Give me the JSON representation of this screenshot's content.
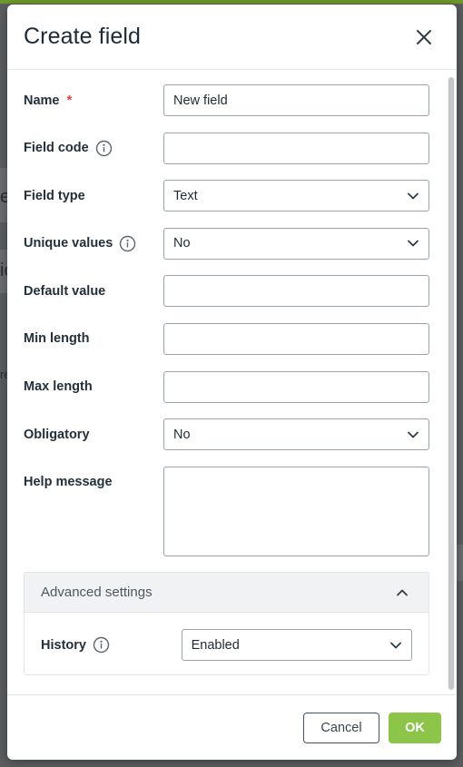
{
  "modal": {
    "title": "Create field",
    "close_icon": "close-icon"
  },
  "fields": {
    "name": {
      "label": "Name",
      "required_mark": "*",
      "value": "New field"
    },
    "field_code": {
      "label": "Field code",
      "value": ""
    },
    "field_type": {
      "label": "Field type",
      "value": "Text"
    },
    "unique_values": {
      "label": "Unique values",
      "value": "No"
    },
    "default_value": {
      "label": "Default value",
      "value": ""
    },
    "min_length": {
      "label": "Min length",
      "value": ""
    },
    "max_length": {
      "label": "Max length",
      "value": ""
    },
    "obligatory": {
      "label": "Obligatory",
      "value": "No"
    },
    "help_message": {
      "label": "Help message",
      "value": ""
    }
  },
  "advanced": {
    "title": "Advanced settings",
    "history": {
      "label": "History",
      "value": "Enabled"
    }
  },
  "footer": {
    "cancel_label": "Cancel",
    "ok_label": "OK"
  },
  "colors": {
    "accent": "#8dc44a",
    "required": "#e0443a",
    "border": "#9aa3ab"
  },
  "background": {
    "frag1": "e",
    "frag2": "ic",
    "frag3": "re"
  }
}
